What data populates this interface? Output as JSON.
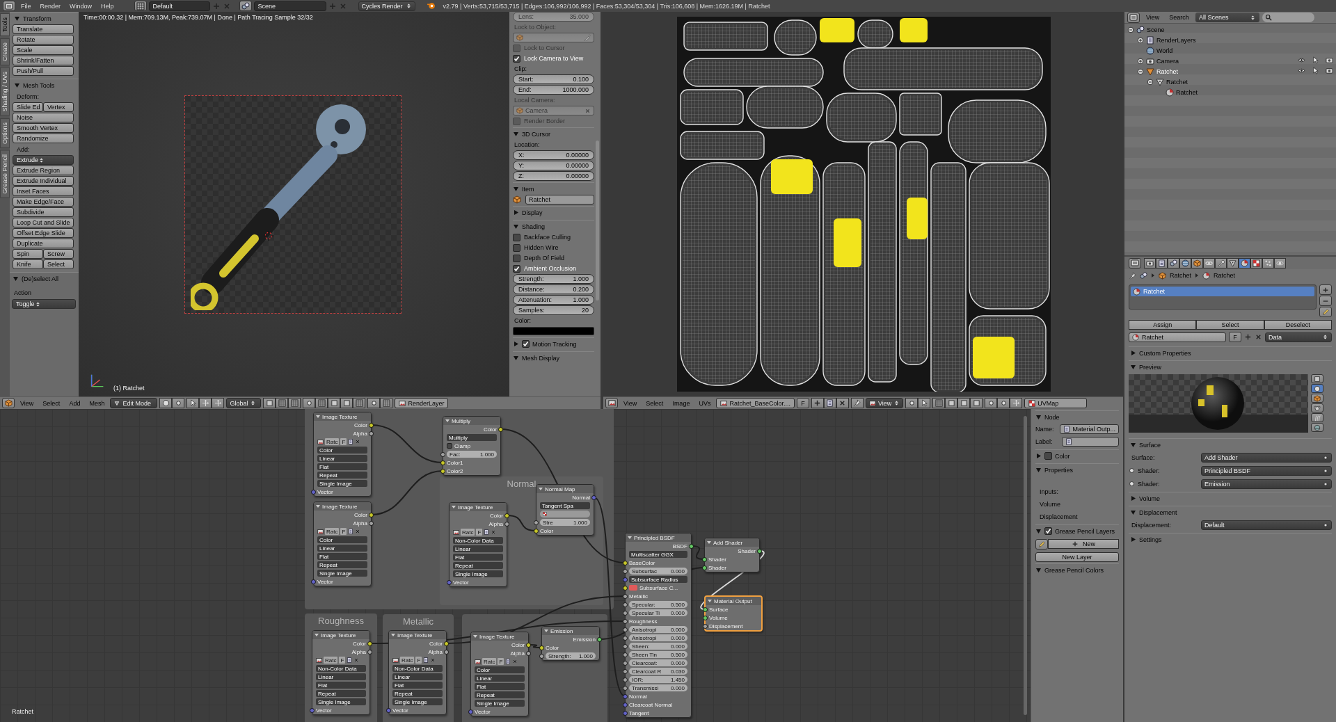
{
  "topbar": {
    "menus": [
      "File",
      "Render",
      "Window",
      "Help"
    ],
    "layout": "Default",
    "scene": "Scene",
    "engine": "Cycles Render",
    "stats": "v2.79 | Verts:53,715/53,715 | Edges:106,992/106,992 | Faces:53,304/53,304 | Tris:106,608 | Mem:1626.19M | Ratchet"
  },
  "tool_tabs": [
    {
      "label": "Tools",
      "selected": true
    },
    {
      "label": "Create",
      "selected": false
    },
    {
      "label": "Shading / UVs",
      "selected": false
    },
    {
      "label": "Options",
      "selected": false
    },
    {
      "label": "Grease Pencil",
      "selected": false
    }
  ],
  "tool_shelf": {
    "panels": [
      {
        "title": "Transform",
        "expanded": true,
        "items": [
          {
            "kind": "button",
            "label": "Translate"
          },
          {
            "kind": "button",
            "label": "Rotate"
          },
          {
            "kind": "button",
            "label": "Scale"
          },
          {
            "kind": "button",
            "label": "Shrink/Fatten"
          },
          {
            "kind": "button",
            "label": "Push/Pull"
          }
        ]
      },
      {
        "title": "Mesh Tools",
        "expanded": true,
        "items": [
          {
            "kind": "label",
            "text": "Deform:"
          },
          {
            "kind": "pair",
            "labels": [
              "Slide Ed",
              "Vertex"
            ]
          },
          {
            "kind": "button",
            "label": "Noise"
          },
          {
            "kind": "button",
            "label": "Smooth Vertex"
          },
          {
            "kind": "button",
            "label": "Randomize"
          },
          {
            "kind": "label",
            "text": "Add:"
          },
          {
            "kind": "dropdown",
            "value": "Extrude"
          },
          {
            "kind": "button",
            "label": "Extrude Region"
          },
          {
            "kind": "button",
            "label": "Extrude Individual"
          },
          {
            "kind": "button",
            "label": "Inset Faces"
          },
          {
            "kind": "button",
            "label": "Make Edge/Face"
          },
          {
            "kind": "button",
            "label": "Subdivide"
          },
          {
            "kind": "button",
            "label": "Loop Cut and Slide"
          },
          {
            "kind": "button",
            "label": "Offset Edge Slide"
          },
          {
            "kind": "button",
            "label": "Duplicate"
          },
          {
            "kind": "pair",
            "labels": [
              "Spin",
              "Screw"
            ]
          },
          {
            "kind": "pair",
            "labels": [
              "Knife",
              "Select"
            ]
          }
        ]
      }
    ],
    "operator": {
      "title": "(De)select All",
      "expanded": true,
      "label": "Action",
      "value": "Toggle"
    }
  },
  "viewport": {
    "render_info": "Time:00:00.32 | Mem:709.13M, Peak:739.07M | Done | Path Tracing Sample 32/32",
    "object_label": "(1) Ratchet"
  },
  "view3d_panel": {
    "items": [
      {
        "kind": "field",
        "label": "Lens:",
        "value": "35.000",
        "disabled": true
      },
      {
        "kind": "label",
        "text": "Lock to Object:",
        "disabled": true
      },
      {
        "kind": "object_field",
        "disabled": true
      },
      {
        "kind": "check",
        "label": "Lock to Cursor",
        "checked": false,
        "disabled": true
      },
      {
        "kind": "check",
        "label": "Lock Camera to View",
        "checked": true,
        "disabled": false
      },
      {
        "kind": "label",
        "text": "Clip:",
        "disabled": false
      },
      {
        "kind": "field",
        "label": "Start:",
        "value": "0.100",
        "disabled": false
      },
      {
        "kind": "field",
        "label": "End:",
        "value": "1000.000",
        "disabled": false
      },
      {
        "kind": "label",
        "text": "Local Camera:",
        "disabled": true
      },
      {
        "kind": "object_field",
        "value": "Camera",
        "disabled": true
      },
      {
        "kind": "check",
        "label": "Render Border",
        "checked": false,
        "disabled": true
      },
      {
        "kind": "header",
        "title": "3D Cursor",
        "expanded": true
      },
      {
        "kind": "label",
        "text": "Location:",
        "disabled": false
      },
      {
        "kind": "field",
        "label": "X:",
        "value": "0.00000",
        "disabled": false
      },
      {
        "kind": "field",
        "label": "Y:",
        "value": "0.00000",
        "disabled": false
      },
      {
        "kind": "field",
        "label": "Z:",
        "value": "0.00000",
        "disabled": false
      },
      {
        "kind": "header",
        "title": "Item",
        "expanded": true
      },
      {
        "kind": "name_field",
        "value": "Ratchet"
      },
      {
        "kind": "header",
        "title": "Display",
        "expanded": false
      },
      {
        "kind": "header",
        "title": "Shading",
        "expanded": true
      },
      {
        "kind": "check",
        "label": "Backface Culling",
        "checked": false,
        "disabled": false
      },
      {
        "kind": "check",
        "label": "Hidden Wire",
        "checked": false,
        "disabled": false
      },
      {
        "kind": "check",
        "label": "Depth Of Field",
        "checked": false,
        "disabled": false
      },
      {
        "kind": "check",
        "label": "Ambient Occlusion",
        "checked": true,
        "disabled": false
      },
      {
        "kind": "field",
        "label": "Strength:",
        "value": "1.000",
        "disabled": false
      },
      {
        "kind": "field",
        "label": "Distance:",
        "value": "0.200",
        "disabled": false
      },
      {
        "kind": "field",
        "label": "Attenuation:",
        "value": "1.000",
        "disabled": false
      },
      {
        "kind": "field",
        "label": "Samples:",
        "value": "20",
        "disabled": false
      },
      {
        "kind": "label",
        "text": "Color:",
        "disabled": false
      },
      {
        "kind": "swatch",
        "color": "#000000"
      },
      {
        "kind": "header",
        "title": "Motion Tracking",
        "expanded": false,
        "checked": true
      },
      {
        "kind": "header",
        "title": "Mesh Display",
        "expanded": true
      }
    ]
  },
  "view3d_header": {
    "menus": [
      "View",
      "Select",
      "Add",
      "Mesh"
    ],
    "mode": "Edit Mode",
    "orientation": "Global",
    "layer_button": "RenderLayer"
  },
  "image_header": {
    "menus": [
      "View",
      "Select",
      "Image",
      "UVs"
    ],
    "image": "Ratchet_BaseColor....",
    "fake_user": "F",
    "view": "View",
    "uv_map": "UVMap"
  },
  "outliner": {
    "menus": [
      "View",
      "Search"
    ],
    "filter": "All Scenes",
    "tree": [
      {
        "label": "Scene",
        "kind": "scene",
        "expanded": true,
        "selected": false,
        "children": [
          {
            "label": "RenderLayers",
            "kind": "renderlayers",
            "expanded": false,
            "selected": false
          },
          {
            "label": "World",
            "kind": "world",
            "selected": false
          },
          {
            "label": "Camera",
            "kind": "camera",
            "expanded": false,
            "selected": false
          },
          {
            "label": "Ratchet",
            "kind": "object",
            "expanded": true,
            "selected": true,
            "children": [
              {
                "label": "Ratchet",
                "kind": "mesh",
                "expanded": true,
                "selected": false,
                "children": [
                  {
                    "label": "Ratchet",
                    "kind": "material",
                    "selected": false
                  }
                ]
              }
            ]
          }
        ]
      }
    ]
  },
  "properties": {
    "tabs": [
      {
        "kind": "render",
        "selected": false
      },
      {
        "kind": "layers",
        "selected": false
      },
      {
        "kind": "scene",
        "selected": false
      },
      {
        "kind": "world",
        "selected": false
      },
      {
        "kind": "object",
        "selected": false
      },
      {
        "kind": "constraints",
        "selected": false
      },
      {
        "kind": "modifiers",
        "selected": false
      },
      {
        "kind": "data",
        "selected": false
      },
      {
        "kind": "material",
        "selected": true
      },
      {
        "kind": "texture",
        "selected": false
      },
      {
        "kind": "particles",
        "selected": false
      },
      {
        "kind": "physics",
        "selected": false
      }
    ],
    "breadcrumb": [
      "Ratchet",
      "Ratchet"
    ],
    "slots": [
      {
        "label": "Ratchet",
        "selected": true
      }
    ],
    "slot_actions": [
      "Assign",
      "Select",
      "Deselect"
    ],
    "material": {
      "name": "Ratchet",
      "fake_user": "F",
      "link": "Data"
    },
    "preview_shapes": [
      {
        "kind": "flat",
        "selected": false
      },
      {
        "kind": "sphere",
        "selected": true
      },
      {
        "kind": "cube",
        "selected": false
      },
      {
        "kind": "monkey",
        "selected": false
      },
      {
        "kind": "hair",
        "selected": false
      },
      {
        "kind": "sky",
        "selected": false
      }
    ],
    "panels": [
      {
        "title": "Custom Properties",
        "kind": "plain",
        "expanded": false
      },
      {
        "title": "Preview",
        "kind": "preview",
        "expanded": true
      },
      {
        "title": "Surface",
        "kind": "rows",
        "expanded": true,
        "rows": [
          {
            "label": "Surface:",
            "value": "Add Shader",
            "socket": false
          },
          {
            "label": "Shader:",
            "value": "Principled BSDF",
            "socket": true
          },
          {
            "label": "Shader:",
            "value": "Emission",
            "socket": true
          }
        ]
      },
      {
        "title": "Volume",
        "kind": "plain",
        "expanded": false
      },
      {
        "title": "Displacement",
        "kind": "rows",
        "expanded": true,
        "rows": [
          {
            "label": "Displacement:",
            "value": "Default",
            "socket": false
          }
        ]
      },
      {
        "title": "Settings",
        "kind": "plain",
        "expanded": false
      }
    ]
  },
  "node_panel": {
    "panels": [
      {
        "title": "Node",
        "kind": "fields",
        "expanded": true,
        "rows": [
          {
            "label": "Name:",
            "value": "Material Outp..."
          },
          {
            "label": "Label:"
          }
        ]
      },
      {
        "title": "Color",
        "kind": "plain",
        "expanded": false,
        "checked": false
      },
      {
        "title": "Properties",
        "kind": "labels",
        "expanded": true,
        "rows": [
          {
            "label": "Inputs:"
          },
          {
            "label": "Volume"
          },
          {
            "label": "Displacement"
          }
        ]
      },
      {
        "title": "Grease Pencil Layers",
        "kind": "grease",
        "expanded": true,
        "checked": true,
        "buttons": [
          "New",
          "New Layer"
        ]
      },
      {
        "title": "Grease Pencil Colors",
        "kind": "plain",
        "expanded": true
      }
    ]
  },
  "node_editor": {
    "material_label": "Ratchet",
    "frames": [
      {
        "label": "Normal"
      },
      {
        "label": "Roughness"
      },
      {
        "label": "Metallic"
      }
    ],
    "nodes": [
      {
        "title": "Image Texture",
        "selected": false,
        "rows": [
          {
            "kind": "out",
            "label": "Color",
            "socket": {
              "color": "#c7c729"
            }
          },
          {
            "kind": "out",
            "label": "Alpha",
            "socket": {
              "color": "#a1a1a1"
            }
          },
          {
            "kind": "image_bar",
            "image": "Ratc",
            "fake_user": "F"
          },
          {
            "kind": "dropdown",
            "value": "Color"
          },
          {
            "kind": "dropdown",
            "value": "Linear"
          },
          {
            "kind": "dropdown",
            "value": "Flat"
          },
          {
            "kind": "dropdown",
            "value": "Repeat"
          },
          {
            "kind": "dropdown",
            "value": "Single Image"
          },
          {
            "kind": "in",
            "label": "Vector",
            "socket": {
              "color": "#6363c7"
            }
          }
        ]
      },
      {
        "title": "Image Texture",
        "selected": false,
        "rows": [
          {
            "kind": "out",
            "label": "Color",
            "socket": {
              "color": "#c7c729"
            }
          },
          {
            "kind": "out",
            "label": "Alpha",
            "socket": {
              "color": "#a1a1a1"
            }
          },
          {
            "kind": "image_bar",
            "image": "Ratc",
            "fake_user": "F"
          },
          {
            "kind": "dropdown",
            "value": "Color"
          },
          {
            "kind": "dropdown",
            "value": "Linear"
          },
          {
            "kind": "dropdown",
            "value": "Flat"
          },
          {
            "kind": "dropdown",
            "value": "Repeat"
          },
          {
            "kind": "dropdown",
            "value": "Single Image"
          },
          {
            "kind": "in",
            "label": "Vector",
            "socket": {
              "color": "#6363c7"
            }
          }
        ]
      },
      {
        "title": "Multiply",
        "selected": false,
        "rows": [
          {
            "kind": "out",
            "label": "Color",
            "socket": {
              "color": "#c7c729"
            }
          },
          {
            "kind": "dropdown",
            "value": "Multiply"
          },
          {
            "kind": "check",
            "label": "Clamp",
            "checked": false
          },
          {
            "kind": "field",
            "label": "Fac:",
            "value": "1.000",
            "socket": {
              "color": "#a1a1a1"
            }
          },
          {
            "kind": "in",
            "label": "Color1",
            "socket": {
              "color": "#c7c729"
            }
          },
          {
            "kind": "in",
            "label": "Color2",
            "socket": {
              "color": "#c7c729"
            }
          }
        ]
      },
      {
        "title": "Image Texture",
        "selected": false,
        "rows": [
          {
            "kind": "out",
            "label": "Color",
            "socket": {
              "color": "#c7c729"
            }
          },
          {
            "kind": "out",
            "label": "Alpha",
            "socket": {
              "color": "#a1a1a1"
            }
          },
          {
            "kind": "image_bar",
            "image": "Ratc",
            "fake_user": "F"
          },
          {
            "kind": "dropdown",
            "value": "Non-Color Data"
          },
          {
            "kind": "dropdown",
            "value": "Linear"
          },
          {
            "kind": "dropdown",
            "value": "Flat"
          },
          {
            "kind": "dropdown",
            "value": "Repeat"
          },
          {
            "kind": "dropdown",
            "value": "Single Image"
          },
          {
            "kind": "in",
            "label": "Vector",
            "socket": {
              "color": "#6363c7"
            }
          }
        ]
      },
      {
        "title": "Normal Map",
        "selected": false,
        "rows": [
          {
            "kind": "out",
            "label": "Normal",
            "socket": {
              "color": "#6363c7"
            }
          },
          {
            "kind": "dropdown",
            "value": "Tangent Spa"
          },
          {
            "kind": "uv_field"
          },
          {
            "kind": "field",
            "label": "Stre",
            "value": "1.000",
            "socket": {
              "color": "#a1a1a1"
            }
          },
          {
            "kind": "in",
            "label": "Color",
            "socket": {
              "color": "#c7c729"
            }
          }
        ]
      },
      {
        "title": "Image Texture",
        "selected": false,
        "rows": [
          {
            "kind": "out",
            "label": "Color",
            "socket": {
              "color": "#c7c729"
            }
          },
          {
            "kind": "out",
            "label": "Alpha",
            "socket": {
              "color": "#a1a1a1"
            }
          },
          {
            "kind": "image_bar",
            "image": "Ratc",
            "fake_user": "F"
          },
          {
            "kind": "dropdown",
            "value": "Non-Color Data"
          },
          {
            "kind": "dropdown",
            "value": "Linear"
          },
          {
            "kind": "dropdown",
            "value": "Flat"
          },
          {
            "kind": "dropdown",
            "value": "Repeat"
          },
          {
            "kind": "dropdown",
            "value": "Single Image"
          },
          {
            "kind": "in",
            "label": "Vector",
            "socket": {
              "color": "#6363c7"
            }
          }
        ]
      },
      {
        "title": "Image Texture",
        "selected": false,
        "rows": [
          {
            "kind": "out",
            "label": "Color",
            "socket": {
              "color": "#c7c729"
            }
          },
          {
            "kind": "out",
            "label": "Alpha",
            "socket": {
              "color": "#a1a1a1"
            }
          },
          {
            "kind": "image_bar",
            "image": "Ratc",
            "fake_user": "F"
          },
          {
            "kind": "dropdown",
            "value": "Non-Color Data"
          },
          {
            "kind": "dropdown",
            "value": "Linear"
          },
          {
            "kind": "dropdown",
            "value": "Flat"
          },
          {
            "kind": "dropdown",
            "value": "Repeat"
          },
          {
            "kind": "dropdown",
            "value": "Single Image"
          },
          {
            "kind": "in",
            "label": "Vector",
            "socket": {
              "color": "#6363c7"
            }
          }
        ]
      },
      {
        "title": "Image Texture",
        "selected": false,
        "rows": [
          {
            "kind": "out",
            "label": "Color",
            "socket": {
              "color": "#c7c729"
            }
          },
          {
            "kind": "out",
            "label": "Alpha",
            "socket": {
              "color": "#a1a1a1"
            }
          },
          {
            "kind": "image_bar",
            "image": "Ratc",
            "fake_user": "F"
          },
          {
            "kind": "dropdown",
            "value": "Color"
          },
          {
            "kind": "dropdown",
            "value": "Linear"
          },
          {
            "kind": "dropdown",
            "value": "Flat"
          },
          {
            "kind": "dropdown",
            "value": "Repeat"
          },
          {
            "kind": "dropdown",
            "value": "Single Image"
          },
          {
            "kind": "in",
            "label": "Vector",
            "socket": {
              "color": "#6363c7"
            }
          }
        ]
      },
      {
        "title": "Emission",
        "selected": false,
        "rows": [
          {
            "kind": "out",
            "label": "Emission",
            "socket": {
              "color": "#63c763"
            }
          },
          {
            "kind": "in",
            "label": "Color",
            "socket": {
              "color": "#c7c729"
            }
          },
          {
            "kind": "field",
            "label": "Strength:",
            "value": "1.000",
            "socket": {
              "color": "#a1a1a1"
            }
          }
        ]
      },
      {
        "title": "Principled BSDF",
        "selected": false,
        "rows": [
          {
            "kind": "out",
            "label": "BSDF",
            "socket": {
              "color": "#63c763"
            }
          },
          {
            "kind": "dropdown",
            "value": "Multiscatter GGX"
          },
          {
            "kind": "in",
            "label": "BaseColor",
            "socket": {
              "color": "#c7c729"
            }
          },
          {
            "kind": "field",
            "label": "Subsurfac",
            "value": "0.000",
            "socket": {
              "color": "#a1a1a1"
            }
          },
          {
            "kind": "dropdown",
            "value": "Subsurface Radius",
            "socket": {
              "color": "#6363c7"
            }
          },
          {
            "kind": "swatch",
            "label": "Subsurface C...",
            "color": "#e05a5a",
            "socket": {
              "color": "#c7c729"
            }
          },
          {
            "kind": "in",
            "label": "Metallic",
            "socket": {
              "color": "#a1a1a1"
            }
          },
          {
            "kind": "field",
            "label": "Specular:",
            "value": "0.500",
            "socket": {
              "color": "#a1a1a1"
            }
          },
          {
            "kind": "field",
            "label": "Specular Ti",
            "value": "0.000",
            "socket": {
              "color": "#a1a1a1"
            }
          },
          {
            "kind": "in",
            "label": "Roughness",
            "socket": {
              "color": "#a1a1a1"
            }
          },
          {
            "kind": "field",
            "label": "Anisotropi",
            "value": "0.000",
            "socket": {
              "color": "#a1a1a1"
            }
          },
          {
            "kind": "field",
            "label": "Anisotropi",
            "value": "0.000",
            "socket": {
              "color": "#a1a1a1"
            }
          },
          {
            "kind": "field",
            "label": "Sheen:",
            "value": "0.000",
            "socket": {
              "color": "#a1a1a1"
            }
          },
          {
            "kind": "field",
            "label": "Sheen Tin",
            "value": "0.500",
            "socket": {
              "color": "#a1a1a1"
            }
          },
          {
            "kind": "field",
            "label": "Clearcoat:",
            "value": "0.000",
            "socket": {
              "color": "#a1a1a1"
            }
          },
          {
            "kind": "field",
            "label": "Clearcoat R",
            "value": "0.030",
            "socket": {
              "color": "#a1a1a1"
            }
          },
          {
            "kind": "field",
            "label": "IOR:",
            "value": "1.450",
            "socket": {
              "color": "#a1a1a1"
            }
          },
          {
            "kind": "field",
            "label": "Transmissi",
            "value": "0.000",
            "socket": {
              "color": "#a1a1a1"
            }
          },
          {
            "kind": "in",
            "label": "Normal",
            "socket": {
              "color": "#6363c7"
            }
          },
          {
            "kind": "in",
            "label": "Clearcoat Normal",
            "socket": {
              "color": "#6363c7"
            }
          },
          {
            "kind": "in",
            "label": "Tangent",
            "socket": {
              "color": "#6363c7"
            }
          }
        ]
      },
      {
        "title": "Add Shader",
        "selected": false,
        "rows": [
          {
            "kind": "out",
            "label": "Shader",
            "socket": {
              "color": "#63c763"
            }
          },
          {
            "kind": "in",
            "label": "Shader",
            "socket": {
              "color": "#63c763"
            }
          },
          {
            "kind": "in",
            "label": "Shader",
            "socket": {
              "color": "#63c763"
            }
          }
        ]
      },
      {
        "title": "Material Output",
        "selected": true,
        "rows": [
          {
            "kind": "in",
            "label": "Surface",
            "socket": {
              "color": "#63c763"
            }
          },
          {
            "kind": "in",
            "label": "Volume",
            "socket": {
              "color": "#63c763"
            }
          },
          {
            "kind": "in",
            "label": "Displacement",
            "socket": {
              "color": "#a1a1a1"
            }
          }
        ]
      }
    ]
  }
}
